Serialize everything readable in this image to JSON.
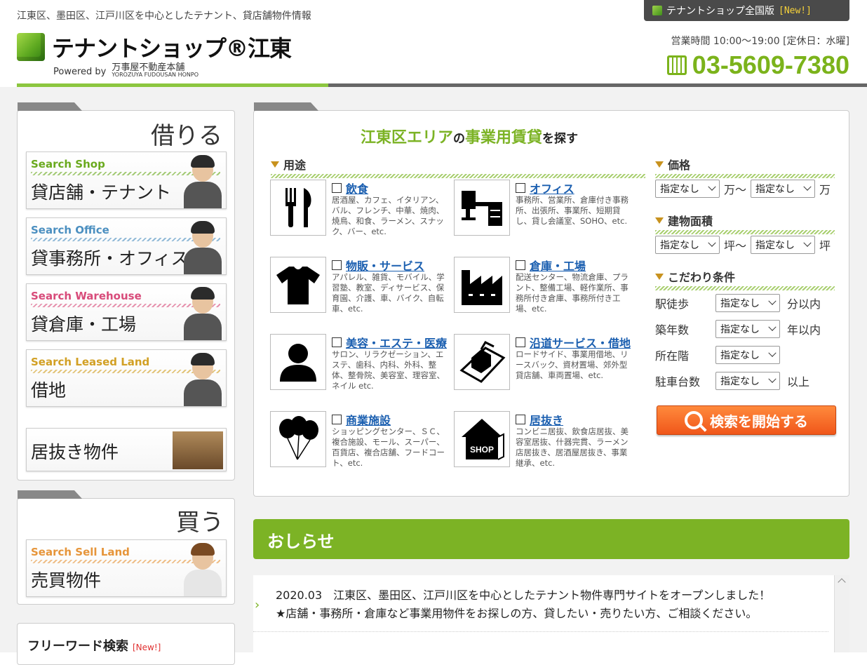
{
  "header": {
    "tagline": "江東区、墨田区、江戸川区を中心としたテナント、貸店舗物件情報",
    "national_tab": {
      "label": "テナントショップ全国版",
      "badge": "[New!]"
    },
    "logo": {
      "name": "テナントショップ®江東",
      "powered": "Powered by",
      "company": "万事屋不動産本舗",
      "company_en": "YOROZUYA FUDOUSAN HONPO"
    },
    "hours": "営業時間 10:00〜19:00 [定休日：水曜]",
    "phone": "03-5609-7380"
  },
  "sidebar": {
    "rent_heading": "借りる",
    "rent_items": [
      {
        "en": "Search Shop",
        "jp": "貸店舗・テナント",
        "color": "#6aaa1e"
      },
      {
        "en": "Search Office",
        "jp": "貸事務所・オフィス",
        "color": "#4b8fc0"
      },
      {
        "en": "Search Warehouse",
        "jp": "貸倉庫・工場",
        "color": "#d84b7a"
      },
      {
        "en": "Search Leased Land",
        "jp": "借地",
        "color": "#d2a024"
      }
    ],
    "inuki": "居抜き物件",
    "buy_heading": "買う",
    "buy_items": [
      {
        "en": "Search Sell Land",
        "jp": "売買物件",
        "color": "#e6953a"
      }
    ],
    "freeword": {
      "title": "フリーワード検索",
      "badge": "[New!]"
    }
  },
  "main": {
    "title_area": "江東区エリア",
    "title_no": "の",
    "title_kind": "事業用賃貸",
    "title_tail": "を探す",
    "usage_heading": "用途",
    "categories": [
      {
        "name": "飲食",
        "desc": "居酒屋、カフェ、イタリアン、バル、フレンチ、中華、焼肉、焼鳥、和食、ラーメン、スナック、バー、etc."
      },
      {
        "name": "オフィス",
        "desc": "事務所、営業所、倉庫付き事務所、出張所、事業所、短期貸し、貸し会議室、SOHO、etc."
      },
      {
        "name": "物販・サービス",
        "desc": "アパレル、雑貨、モバイル、学習塾、教室、ディサービス、保育園、介護、車、バイク、自転車、etc."
      },
      {
        "name": "倉庫・工場",
        "desc": "配送センター、物流倉庫、プラント、整備工場、軽作業所、事務所付き倉庫、事務所付き工場、etc."
      },
      {
        "name": "美容・エステ・医療",
        "desc": "サロン、リラクゼーション、エステ、歯科、内科、外科、整体、整骨院、美容室、理容室、ネイル etc."
      },
      {
        "name": "沿道サービス・借地",
        "desc": "ロードサイド、事業用借地、リースバック、資材置場、郊外型貸店舗、車両置場、etc."
      },
      {
        "name": "商業施設",
        "desc": "ショッピングセンター、ＳＣ、複合施設、モール、スーパー、百貨店、複合店舗、フードコート、etc."
      },
      {
        "name": "居抜き",
        "desc": "コンビニ居抜、飲食店居抜、美容室居抜、什器完貫、ラーメン店居抜き、居酒屋居抜き、事業継承、etc."
      }
    ],
    "price": {
      "heading": "価格",
      "from": "指定なし",
      "mid": "万〜",
      "to": "指定なし",
      "unit": "万"
    },
    "area": {
      "heading": "建物面積",
      "from": "指定なし",
      "mid": "坪〜",
      "to": "指定なし",
      "unit": "坪"
    },
    "conditions": {
      "heading": "こだわり条件",
      "rows": [
        {
          "label": "駅徒歩",
          "value": "指定なし",
          "suffix": "分以内"
        },
        {
          "label": "築年数",
          "value": "指定なし",
          "suffix": "年以内"
        },
        {
          "label": "所在階",
          "value": "指定なし",
          "suffix": ""
        },
        {
          "label": "駐車台数",
          "value": "指定なし",
          "suffix": "以上"
        }
      ]
    },
    "search_button": "検索を開始する",
    "shop_sign": "SHOP"
  },
  "news": {
    "heading": "おしらせ",
    "line1": "2020.03　江東区、墨田区、江戸川区を中心としたテナント物件専門サイトをオープンしました！",
    "line2": "★店舗・事務所・倉庫など事業用物件をお探しの方、貸したい・売りたい方、ご相談ください。"
  },
  "colors": {
    "brand_green": "#7cb325",
    "accent_orange": "#f0561a",
    "link_blue": "#1b5fb0"
  }
}
